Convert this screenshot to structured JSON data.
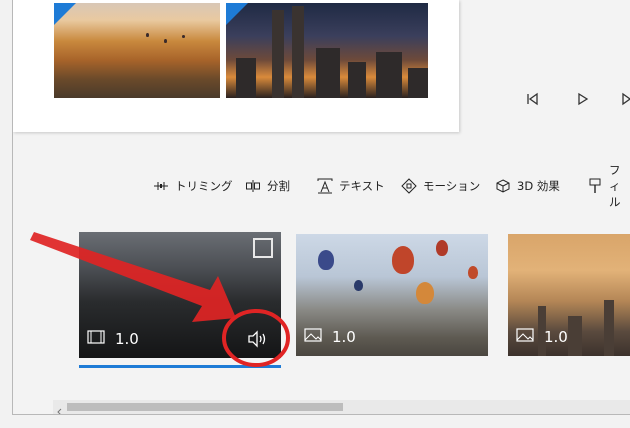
{
  "toolbar": {
    "trim_label": "トリミング",
    "split_label": "分割",
    "text_label": "テキスト",
    "motion_label": "モーション",
    "effects3d_label": "3D 効果",
    "filter_label": "フィル"
  },
  "storyboard": {
    "clips": [
      {
        "duration": "1.0",
        "kind": "video",
        "has_audio": true,
        "selected": true
      },
      {
        "duration": "1.0",
        "kind": "image"
      },
      {
        "duration": "1.0",
        "kind": "image"
      }
    ]
  },
  "colors": {
    "accent": "#1e7bd6",
    "annotation_red": "#e02424"
  },
  "icons": {
    "trim": "trim-icon",
    "split": "split-icon",
    "text": "text-icon",
    "motion": "motion-icon",
    "effects3d": "3d-effects-icon",
    "filter": "filter-icon",
    "prev_frame": "previous-frame-icon",
    "play": "play-icon",
    "next_frame": "next-frame-icon",
    "video_clip": "film-icon",
    "image_clip": "image-icon",
    "audio": "speaker-icon"
  }
}
